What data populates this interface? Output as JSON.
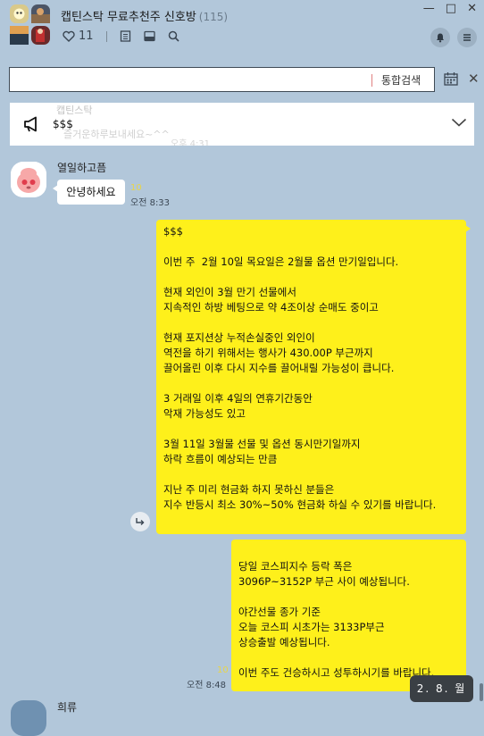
{
  "room": {
    "title": "캡틴스탁 무료추천주 신호방",
    "member_count": "(115)"
  },
  "window_controls": {
    "minimize": "—",
    "maximize": "□",
    "close": "✕"
  },
  "toolbar": {
    "likes_count": "11",
    "icons": [
      "heart-icon",
      "document-icon",
      "inbox-icon",
      "search-icon"
    ]
  },
  "right_toolbar": {
    "icons": [
      "bell-icon",
      "menu-icon"
    ]
  },
  "search": {
    "value": "",
    "button_label": "통합검색"
  },
  "notice": {
    "text": "$$$",
    "ghost_name": "캡틴스탁",
    "ghost_message": "즐거운하루보내세요~^^",
    "ghost_time": "오후 4:31"
  },
  "messages": [
    {
      "sender": "열일하고픔",
      "text": "안녕하세요",
      "unread": "10",
      "time": "오전 8:33"
    },
    {
      "lines": [
        "$$$",
        "",
        "이번 주  2월 10일 목요일은 2월물 옵션 만기일입니다.",
        "",
        "현재 외인이 3월 만기 선물에서",
        "지속적인 하방 베팅으로 약 4조이상 순매도 중이고",
        "",
        "현재 포지션상 누적손실중인 외인이",
        "역전을 하기 위해서는 행사가 430.00P 부근까지",
        "끌어올린 이후 다시 지수를 끌어내릴 가능성이 큽니다.",
        "",
        "3 거래일 이후 4일의 연휴기간동안",
        "악재 가능성도 있고",
        "",
        "3월 11일 3월물 선물 및 옵션 동시만기일까지",
        "하락 흐름이 예상되는 만큼",
        "",
        "지난 주 미리 현금화 하지 못하신 분들은",
        "지수 반등시 최소 30%~50% 현금화 하실 수 있기를 바랍니다."
      ]
    },
    {
      "lines": [
        "당일 코스피지수 등락 폭은",
        "3096P~3152P 부근 사이 예상됩니다.",
        "",
        "야간선물 종가 기준",
        "오늘 코스피 시초가는 3133P부근",
        "상승출발 예상됩니다.",
        "",
        "이번 주도 건승하시고 성투하시기를 바랍니다."
      ],
      "unread": "10",
      "time": "오전 8:48"
    }
  ],
  "bottom_sender": "희류",
  "date_badge": "2. 8. 월",
  "colors": {
    "background": "#b2c7da",
    "my_bubble": "#fef01b",
    "other_bubble": "#ffffff",
    "unread": "#e8d54a"
  }
}
